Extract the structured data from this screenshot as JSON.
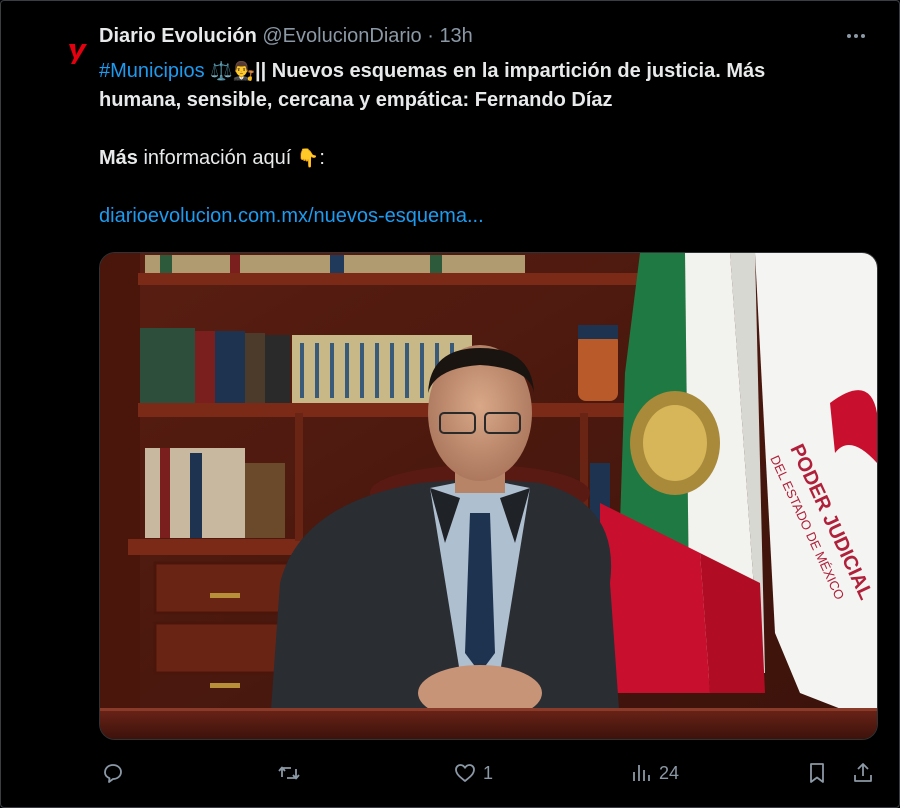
{
  "tweet": {
    "author_name": "Diario Evolución",
    "handle": "@EvolucionDiario",
    "separator": "·",
    "time": "13h",
    "hashtag": "#Municipios",
    "hashtag_emoji": "⚖️👨‍⚖️",
    "headline_part1": "|| Nuevos esquemas en la impartición de justicia. Más",
    "headline_part2": "humana, sensible, cercana y empática: Fernando Díaz",
    "more_bold": "Más",
    "more_text": " información aquí ",
    "more_emoji": "👇",
    "more_colon": ":",
    "link": "diarioevolucion.com.mx/nuevos-esquema..."
  },
  "media": {
    "flag_text_line1": "PODER JUDICIAL",
    "flag_text_line2": "DEL ESTADO DE MÉXICO"
  },
  "actions": {
    "reply_count": "",
    "retweet_count": "",
    "like_count": "1",
    "views_count": "24"
  },
  "colors": {
    "background": "#000000",
    "text": "#e7e9ea",
    "muted": "#8b98a5",
    "link": "#1d9bf0",
    "avatar_red": "#e3000f"
  },
  "icons": [
    "logo-icon",
    "more-icon",
    "reply-icon",
    "retweet-icon",
    "like-icon",
    "views-icon",
    "bookmark-icon",
    "share-icon"
  ]
}
